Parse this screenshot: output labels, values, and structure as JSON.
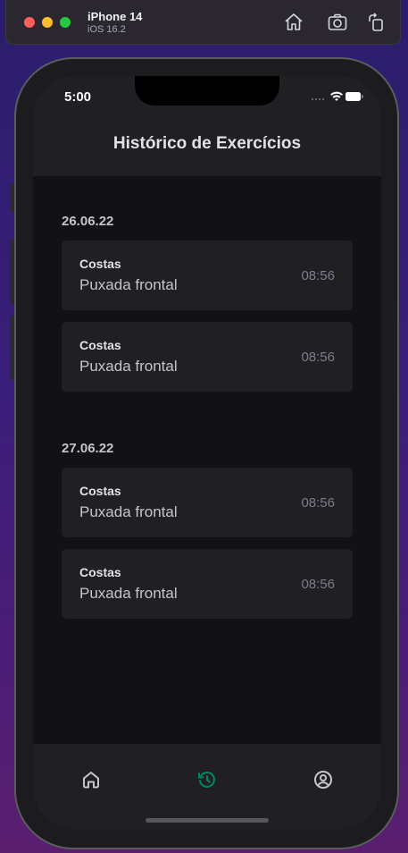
{
  "simulator": {
    "device_name": "iPhone 14",
    "os_version": "iOS 16.2"
  },
  "status_bar": {
    "time": "5:00"
  },
  "header": {
    "title": "Histórico de Exercícios"
  },
  "sections": [
    {
      "date": "26.06.22",
      "items": [
        {
          "group": "Costas",
          "name": "Puxada frontal",
          "time": "08:56"
        },
        {
          "group": "Costas",
          "name": "Puxada frontal",
          "time": "08:56"
        }
      ]
    },
    {
      "date": "27.06.22",
      "items": [
        {
          "group": "Costas",
          "name": "Puxada frontal",
          "time": "08:56"
        },
        {
          "group": "Costas",
          "name": "Puxada frontal",
          "time": "08:56"
        }
      ]
    }
  ],
  "tabbar": {
    "active_tab": "history",
    "active_color": "#00875f",
    "inactive_color": "#c4c4cc",
    "tabs": [
      {
        "id": "home",
        "icon": "house-icon"
      },
      {
        "id": "history",
        "icon": "history-icon"
      },
      {
        "id": "profile",
        "icon": "user-circle-icon"
      }
    ]
  }
}
